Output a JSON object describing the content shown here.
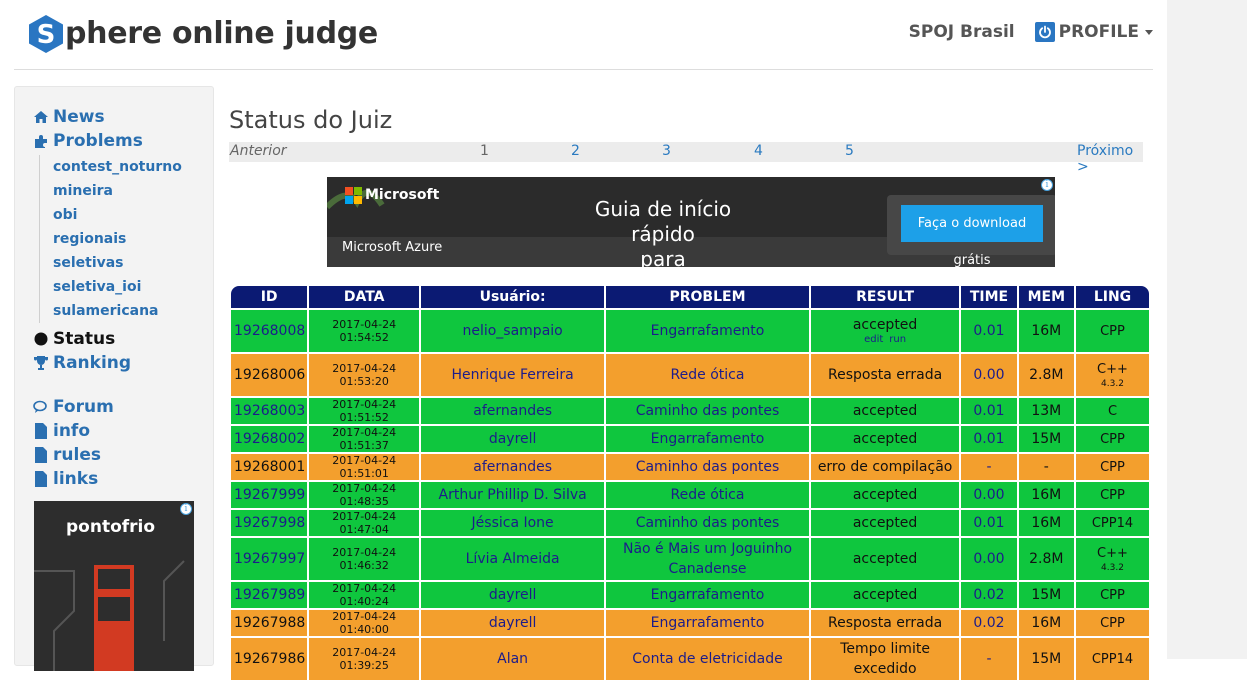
{
  "header": {
    "logo_text": "phere online judge",
    "logo_letter": "S",
    "nav_brasil": "SPOJ Brasil",
    "nav_profile": "PROFILE"
  },
  "sidebar": {
    "news": "News",
    "problems": "Problems",
    "sub_items": [
      "contest_noturno",
      "mineira",
      "obi",
      "regionais",
      "seletivas",
      "seletiva_ioi",
      "sulamericana"
    ],
    "status": "Status",
    "ranking": "Ranking",
    "forum": "Forum",
    "info": "info",
    "rules": "rules",
    "links": "links",
    "ad_brand": "pontofrio"
  },
  "main": {
    "title": "Status do Juiz",
    "pager": {
      "prev": "Anterior",
      "pages": [
        "1",
        "2",
        "3",
        "4",
        "5"
      ],
      "next": "Próximo >"
    }
  },
  "banner": {
    "brand": "Microsoft",
    "product": "Microsoft Azure",
    "tagline_line1": "Guia de início rápido",
    "tagline_line2": "para desenvolvedores",
    "cta": "Faça o download grátis"
  },
  "table": {
    "headers": [
      "ID",
      "DATA",
      "Usuário:",
      "PROBLEM",
      "RESULT",
      "TIME",
      "MEM",
      "LING"
    ],
    "rows": [
      {
        "status": "ok",
        "id": "19268008",
        "date": "2017-04-24 01:54:52",
        "user": "nelio_sampaio",
        "problem": "Engarrafamento",
        "result": "accepted",
        "result_links": [
          "edit",
          "run"
        ],
        "time": "0.01",
        "mem": "16M",
        "lang": "CPP",
        "lang_ver": ""
      },
      {
        "status": "bad",
        "id": "19268006",
        "date": "2017-04-24 01:53:20",
        "user": "Henrique Ferreira",
        "problem": "Rede ótica",
        "result": "Resposta errada",
        "result_links": [],
        "time": "0.00",
        "mem": "2.8M",
        "lang": "C++",
        "lang_ver": "4.3.2"
      },
      {
        "status": "ok",
        "id": "19268003",
        "date": "2017-04-24 01:51:52",
        "user": "afernandes",
        "problem": "Caminho das pontes",
        "result": "accepted",
        "result_links": [],
        "time": "0.01",
        "mem": "13M",
        "lang": "C",
        "lang_ver": ""
      },
      {
        "status": "ok",
        "id": "19268002",
        "date": "2017-04-24 01:51:37",
        "user": "dayrell",
        "problem": "Engarrafamento",
        "result": "accepted",
        "result_links": [],
        "time": "0.01",
        "mem": "15M",
        "lang": "CPP",
        "lang_ver": ""
      },
      {
        "status": "bad",
        "id": "19268001",
        "date": "2017-04-24 01:51:01",
        "user": "afernandes",
        "problem": "Caminho das pontes",
        "result": "erro de compilação",
        "result_links": [],
        "time": "-",
        "mem": "-",
        "lang": "CPP",
        "lang_ver": ""
      },
      {
        "status": "ok",
        "id": "19267999",
        "date": "2017-04-24 01:48:35",
        "user": "Arthur Phillip D. Silva",
        "problem": "Rede ótica",
        "result": "accepted",
        "result_links": [],
        "time": "0.00",
        "mem": "16M",
        "lang": "CPP",
        "lang_ver": ""
      },
      {
        "status": "ok",
        "id": "19267998",
        "date": "2017-04-24 01:47:04",
        "user": "Jéssica Ione",
        "problem": "Caminho das pontes",
        "result": "accepted",
        "result_links": [],
        "time": "0.01",
        "mem": "16M",
        "lang": "CPP14",
        "lang_ver": ""
      },
      {
        "status": "ok",
        "id": "19267997",
        "date": "2017-04-24 01:46:32",
        "user": "Lívia Almeida",
        "problem": "Não é Mais um Joguinho Canadense",
        "result": "accepted",
        "result_links": [],
        "time": "0.00",
        "mem": "2.8M",
        "lang": "C++",
        "lang_ver": "4.3.2"
      },
      {
        "status": "ok",
        "id": "19267989",
        "date": "2017-04-24 01:40:24",
        "user": "dayrell",
        "problem": "Engarrafamento",
        "result": "accepted",
        "result_links": [],
        "time": "0.02",
        "mem": "15M",
        "lang": "CPP",
        "lang_ver": ""
      },
      {
        "status": "bad",
        "id": "19267988",
        "date": "2017-04-24 01:40:00",
        "user": "dayrell",
        "problem": "Engarrafamento",
        "result": "Resposta errada",
        "result_links": [],
        "time": "0.02",
        "mem": "16M",
        "lang": "CPP",
        "lang_ver": ""
      },
      {
        "status": "bad",
        "id": "19267986",
        "date": "2017-04-24 01:39:25",
        "user": "Alan",
        "problem": "Conta de eletricidade",
        "result": "Tempo limite excedido",
        "result_links": [],
        "time": "-",
        "mem": "15M",
        "lang": "CPP14",
        "lang_ver": ""
      }
    ]
  },
  "colors": {
    "accepted_bg": "#0fc63e",
    "error_bg": "#f39f2d",
    "header_bg": "#0b1a73",
    "link": "#2a6fb0",
    "logo_blue": "#2a76c2"
  }
}
